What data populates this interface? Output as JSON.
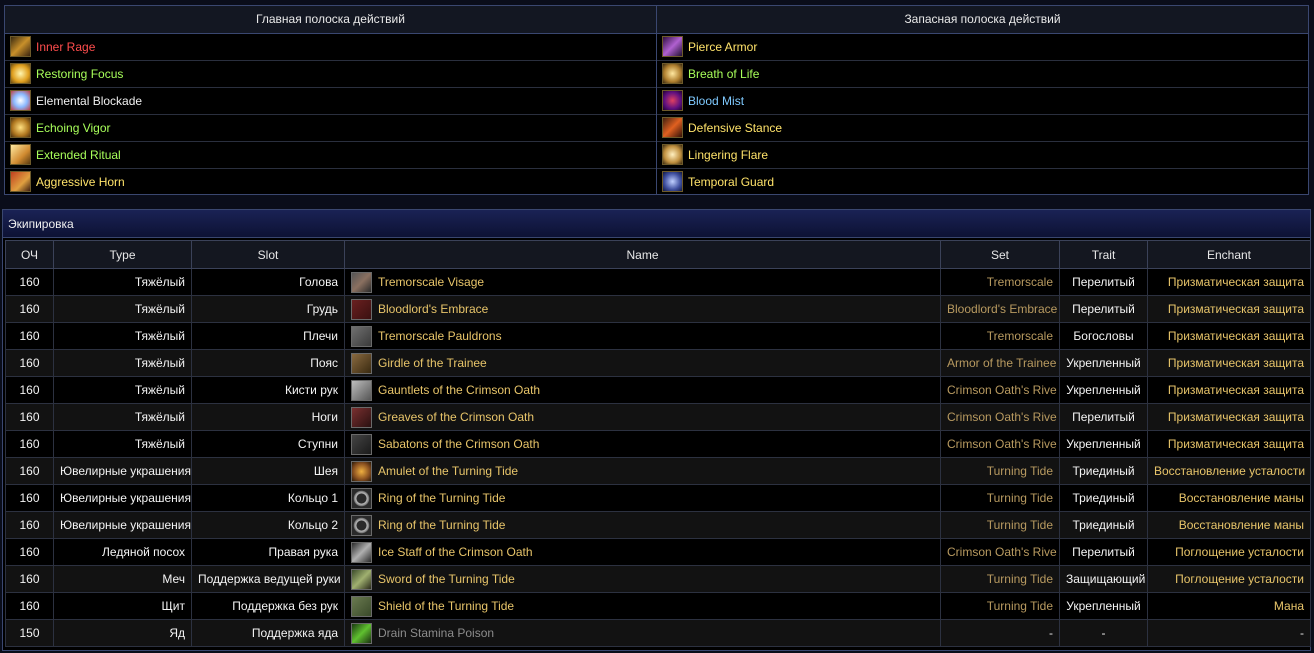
{
  "skillbars": {
    "main_title": "Главная полоска действий",
    "backup_title": "Запасная полоска действий",
    "main": [
      {
        "name": "Inner Rage",
        "color": "#ff4d4d",
        "icon": "rage-icon"
      },
      {
        "name": "Restoring Focus",
        "color": "#a8ff5a",
        "icon": "focus-icon"
      },
      {
        "name": "Elemental Blockade",
        "color": "#f0f0f0",
        "icon": "blockade-icon"
      },
      {
        "name": "Echoing Vigor",
        "color": "#a8ff5a",
        "icon": "vigor-icon"
      },
      {
        "name": "Extended Ritual",
        "color": "#a8ff5a",
        "icon": "ritual-icon"
      },
      {
        "name": "Aggressive Horn",
        "color": "#ffe36a",
        "icon": "horn-icon"
      }
    ],
    "backup": [
      {
        "name": "Pierce Armor",
        "color": "#ffe36a",
        "icon": "pierce-icon"
      },
      {
        "name": "Breath of Life",
        "color": "#a8ff5a",
        "icon": "breath-icon"
      },
      {
        "name": "Blood Mist",
        "color": "#7fcaff",
        "icon": "mist-icon"
      },
      {
        "name": "Defensive Stance",
        "color": "#ffe36a",
        "icon": "stance-icon"
      },
      {
        "name": "Lingering Flare",
        "color": "#ffe36a",
        "icon": "flare-icon"
      },
      {
        "name": "Temporal Guard",
        "color": "#ffe36a",
        "icon": "guard-icon"
      }
    ]
  },
  "equipment": {
    "title": "Экипировка",
    "headers": {
      "cp": "ОЧ",
      "type": "Type",
      "slot": "Slot",
      "name": "Name",
      "set": "Set",
      "trait": "Trait",
      "enchant": "Enchant"
    },
    "rows": [
      {
        "cp": "160",
        "type": "Тяжёлый",
        "slot": "Голова",
        "name": "Tremorscale Visage",
        "set": "Tremorscale",
        "trait": "Перелитый",
        "enchant": "Призматическая защита",
        "icon": "helmet-icon"
      },
      {
        "cp": "160",
        "type": "Тяжёлый",
        "slot": "Грудь",
        "name": "Bloodlord's Embrace",
        "set": "Bloodlord's Embrace",
        "trait": "Перелитый",
        "enchant": "Призматическая защита",
        "icon": "chest-icon"
      },
      {
        "cp": "160",
        "type": "Тяжёлый",
        "slot": "Плечи",
        "name": "Tremorscale Pauldrons",
        "set": "Tremorscale",
        "trait": "Богословы",
        "enchant": "Призматическая защита",
        "icon": "shoulders-icon"
      },
      {
        "cp": "160",
        "type": "Тяжёлый",
        "slot": "Пояс",
        "name": "Girdle of the Trainee",
        "set": "Armor of the Trainee",
        "trait": "Укрепленный",
        "enchant": "Призматическая защита",
        "icon": "belt-icon"
      },
      {
        "cp": "160",
        "type": "Тяжёлый",
        "slot": "Кисти рук",
        "name": "Gauntlets of the Crimson Oath",
        "set": "Crimson Oath's Rive",
        "trait": "Укрепленный",
        "enchant": "Призматическая защита",
        "icon": "gloves-icon"
      },
      {
        "cp": "160",
        "type": "Тяжёлый",
        "slot": "Ноги",
        "name": "Greaves of the Crimson Oath",
        "set": "Crimson Oath's Rive",
        "trait": "Перелитый",
        "enchant": "Призматическая защита",
        "icon": "legs-icon"
      },
      {
        "cp": "160",
        "type": "Тяжёлый",
        "slot": "Ступни",
        "name": "Sabatons of the Crimson Oath",
        "set": "Crimson Oath's Rive",
        "trait": "Укрепленный",
        "enchant": "Призматическая защита",
        "icon": "boots-icon"
      },
      {
        "cp": "160",
        "type": "Ювелирные украшения",
        "slot": "Шея",
        "name": "Amulet of the Turning Tide",
        "set": "Turning Tide",
        "trait": "Триединый",
        "enchant": "Восстановление усталости",
        "icon": "amulet-icon"
      },
      {
        "cp": "160",
        "type": "Ювелирные украшения",
        "slot": "Кольцо 1",
        "name": "Ring of the Turning Tide",
        "set": "Turning Tide",
        "trait": "Триединый",
        "enchant": "Восстановление маны",
        "icon": "ring-icon"
      },
      {
        "cp": "160",
        "type": "Ювелирные украшения",
        "slot": "Кольцо 2",
        "name": "Ring of the Turning Tide",
        "set": "Turning Tide",
        "trait": "Триединый",
        "enchant": "Восстановление маны",
        "icon": "ring-icon"
      },
      {
        "cp": "160",
        "type": "Ледяной посох",
        "slot": "Правая рука",
        "name": "Ice Staff of the Crimson Oath",
        "set": "Crimson Oath's Rive",
        "trait": "Перелитый",
        "enchant": "Поглощение усталости",
        "icon": "staff-icon"
      },
      {
        "cp": "160",
        "type": "Меч",
        "slot": "Поддержка ведущей руки",
        "name": "Sword of the Turning Tide",
        "set": "Turning Tide",
        "trait": "Защищающий",
        "enchant": "Поглощение усталости",
        "icon": "sword-icon"
      },
      {
        "cp": "160",
        "type": "Щит",
        "slot": "Поддержка без рук",
        "name": "Shield of the Turning Tide",
        "set": "Turning Tide",
        "trait": "Укрепленный",
        "enchant": "Мана",
        "icon": "shield-icon"
      },
      {
        "cp": "150",
        "type": "Яд",
        "slot": "Поддержка яда",
        "name": "Drain Stamina Poison",
        "set": "-",
        "trait": "-",
        "enchant": "-",
        "icon": "poison-icon",
        "dim": true
      }
    ]
  }
}
